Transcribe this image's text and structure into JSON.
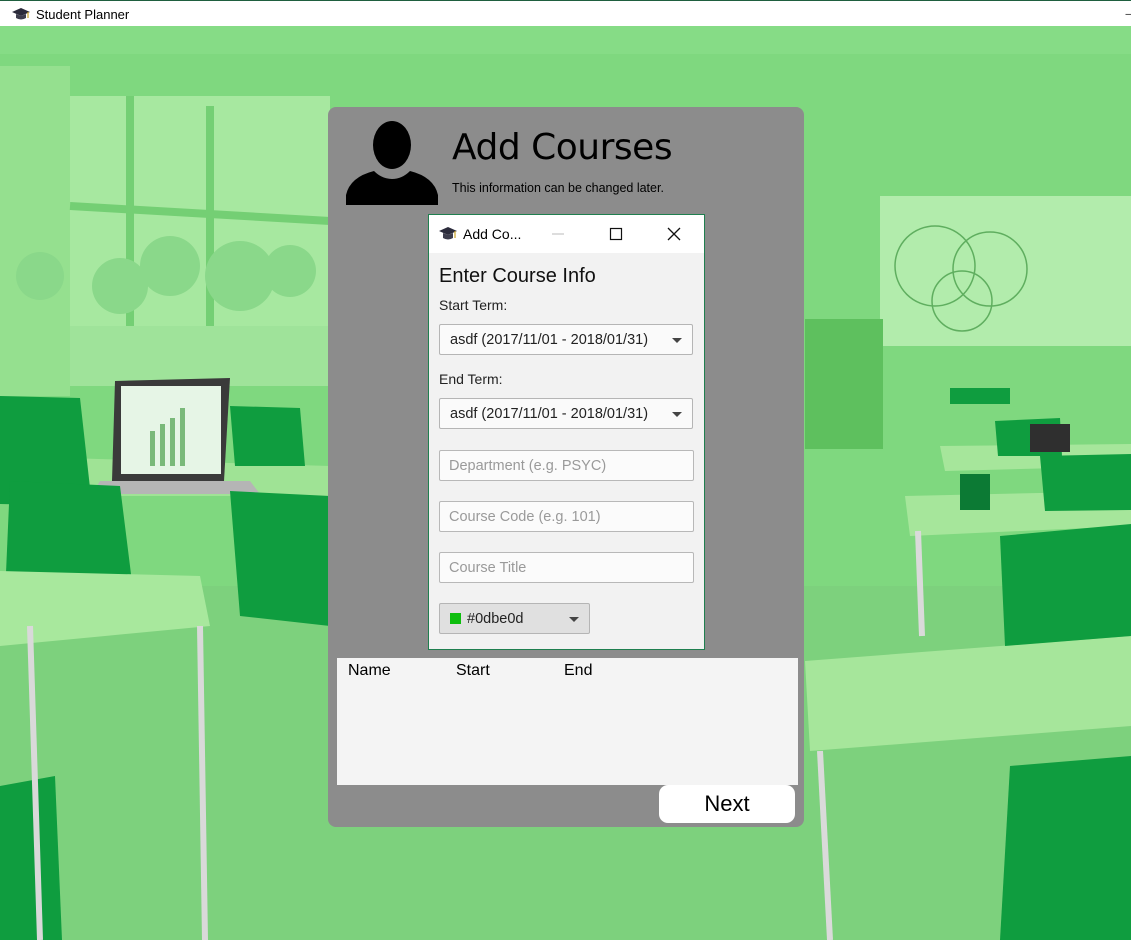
{
  "window": {
    "title": "Student Planner",
    "icon": "graduation-cap-icon"
  },
  "page": {
    "heading": "Add Courses",
    "subheading": "This information can be changed later.",
    "avatar_icon": "person-silhouette-icon"
  },
  "dialog": {
    "title": "Add Co...",
    "icon": "graduation-cap-icon",
    "heading": "Enter Course Info",
    "start_term_label": "Start Term:",
    "start_term_value": "asdf (2017/11/01 - 2018/01/31)",
    "end_term_label": "End Term:",
    "end_term_value": "asdf (2017/11/01 - 2018/01/31)",
    "department_placeholder": "Department (e.g. PSYC)",
    "course_code_placeholder": "Course Code (e.g. 101)",
    "course_title_placeholder": "Course Title",
    "color_value": "#0dbe0d",
    "color_swatch": "#0dbe0d"
  },
  "course_table": {
    "columns": [
      "Name",
      "Start",
      "End"
    ]
  },
  "actions": {
    "next_label": "Next"
  },
  "colors": {
    "background_tint": "#7fd87f",
    "panel": "#8c8c8c",
    "accent": "#0dbe0d"
  }
}
